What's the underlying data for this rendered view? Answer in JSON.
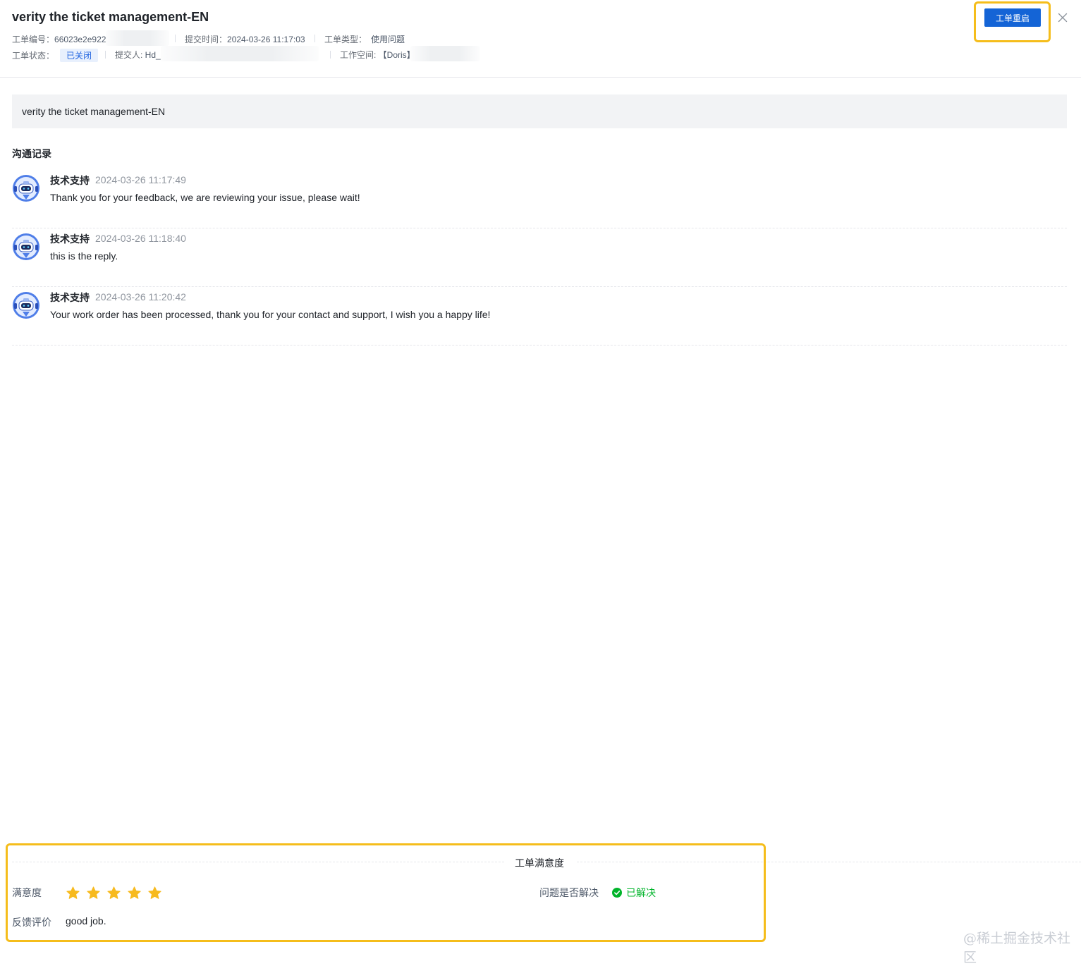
{
  "header": {
    "title": "verity the ticket management-EN",
    "ticket_id_label": "工单编号：",
    "ticket_id_value": "66023e2e922",
    "submit_time_label": "提交时间：",
    "submit_time_value": "2024-03-26 11:17:03",
    "type_label": "工单类型：",
    "type_value": "使用问题",
    "status_label": "工单状态：",
    "status_value": "已关闭",
    "submitter_label": "提交人: ",
    "submitter_value": "Hd_",
    "workspace_label": "工作空间: ",
    "workspace_value": "【Doris】",
    "reopen_button": "工单重启",
    "close_icon": "close-icon"
  },
  "description": "verity the ticket management-EN",
  "communication": {
    "title": "沟通记录",
    "messages": [
      {
        "author": "技术支持",
        "time": "2024-03-26 11:17:49",
        "text": "Thank you for your feedback, we are reviewing your issue, please wait!",
        "avatar_icon": "robot-avatar-icon"
      },
      {
        "author": "技术支持",
        "time": "2024-03-26 11:18:40",
        "text": "this is the reply.",
        "avatar_icon": "robot-avatar-icon"
      },
      {
        "author": "技术支持",
        "time": "2024-03-26 11:20:42",
        "text": "Your work order has been processed, thank you for your contact and support, I wish you a happy life!",
        "avatar_icon": "robot-avatar-icon"
      }
    ]
  },
  "satisfaction": {
    "title": "工单满意度",
    "rating_label": "满意度",
    "rating_value": 5,
    "rating_max": 5,
    "feedback_label": "反馈评价",
    "feedback_value": "good job.",
    "resolved_label": "问题是否解决",
    "resolved_value": "已解决"
  },
  "colors": {
    "primary": "#1464d6",
    "highlight": "#f5bd1b",
    "success": "#00b42a",
    "star": "#f7ba1e"
  },
  "watermark": "@稀土掘金技术社区"
}
